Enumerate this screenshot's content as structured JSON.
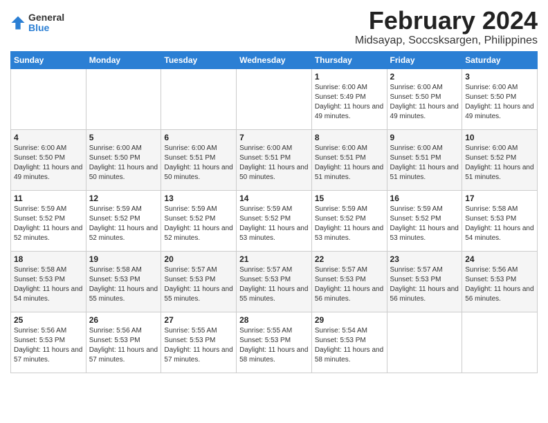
{
  "header": {
    "logo_general": "General",
    "logo_blue": "Blue",
    "title": "February 2024",
    "subtitle": "Midsayap, Soccsksargen, Philippines"
  },
  "days_of_week": [
    "Sunday",
    "Monday",
    "Tuesday",
    "Wednesday",
    "Thursday",
    "Friday",
    "Saturday"
  ],
  "weeks": [
    [
      {
        "day": "",
        "info": ""
      },
      {
        "day": "",
        "info": ""
      },
      {
        "day": "",
        "info": ""
      },
      {
        "day": "",
        "info": ""
      },
      {
        "day": "1",
        "info": "Sunrise: 6:00 AM\nSunset: 5:49 PM\nDaylight: 11 hours and 49 minutes."
      },
      {
        "day": "2",
        "info": "Sunrise: 6:00 AM\nSunset: 5:50 PM\nDaylight: 11 hours and 49 minutes."
      },
      {
        "day": "3",
        "info": "Sunrise: 6:00 AM\nSunset: 5:50 PM\nDaylight: 11 hours and 49 minutes."
      }
    ],
    [
      {
        "day": "4",
        "info": "Sunrise: 6:00 AM\nSunset: 5:50 PM\nDaylight: 11 hours and 49 minutes."
      },
      {
        "day": "5",
        "info": "Sunrise: 6:00 AM\nSunset: 5:50 PM\nDaylight: 11 hours and 50 minutes."
      },
      {
        "day": "6",
        "info": "Sunrise: 6:00 AM\nSunset: 5:51 PM\nDaylight: 11 hours and 50 minutes."
      },
      {
        "day": "7",
        "info": "Sunrise: 6:00 AM\nSunset: 5:51 PM\nDaylight: 11 hours and 50 minutes."
      },
      {
        "day": "8",
        "info": "Sunrise: 6:00 AM\nSunset: 5:51 PM\nDaylight: 11 hours and 51 minutes."
      },
      {
        "day": "9",
        "info": "Sunrise: 6:00 AM\nSunset: 5:51 PM\nDaylight: 11 hours and 51 minutes."
      },
      {
        "day": "10",
        "info": "Sunrise: 6:00 AM\nSunset: 5:52 PM\nDaylight: 11 hours and 51 minutes."
      }
    ],
    [
      {
        "day": "11",
        "info": "Sunrise: 5:59 AM\nSunset: 5:52 PM\nDaylight: 11 hours and 52 minutes."
      },
      {
        "day": "12",
        "info": "Sunrise: 5:59 AM\nSunset: 5:52 PM\nDaylight: 11 hours and 52 minutes."
      },
      {
        "day": "13",
        "info": "Sunrise: 5:59 AM\nSunset: 5:52 PM\nDaylight: 11 hours and 52 minutes."
      },
      {
        "day": "14",
        "info": "Sunrise: 5:59 AM\nSunset: 5:52 PM\nDaylight: 11 hours and 53 minutes."
      },
      {
        "day": "15",
        "info": "Sunrise: 5:59 AM\nSunset: 5:52 PM\nDaylight: 11 hours and 53 minutes."
      },
      {
        "day": "16",
        "info": "Sunrise: 5:59 AM\nSunset: 5:52 PM\nDaylight: 11 hours and 53 minutes."
      },
      {
        "day": "17",
        "info": "Sunrise: 5:58 AM\nSunset: 5:53 PM\nDaylight: 11 hours and 54 minutes."
      }
    ],
    [
      {
        "day": "18",
        "info": "Sunrise: 5:58 AM\nSunset: 5:53 PM\nDaylight: 11 hours and 54 minutes."
      },
      {
        "day": "19",
        "info": "Sunrise: 5:58 AM\nSunset: 5:53 PM\nDaylight: 11 hours and 55 minutes."
      },
      {
        "day": "20",
        "info": "Sunrise: 5:57 AM\nSunset: 5:53 PM\nDaylight: 11 hours and 55 minutes."
      },
      {
        "day": "21",
        "info": "Sunrise: 5:57 AM\nSunset: 5:53 PM\nDaylight: 11 hours and 55 minutes."
      },
      {
        "day": "22",
        "info": "Sunrise: 5:57 AM\nSunset: 5:53 PM\nDaylight: 11 hours and 56 minutes."
      },
      {
        "day": "23",
        "info": "Sunrise: 5:57 AM\nSunset: 5:53 PM\nDaylight: 11 hours and 56 minutes."
      },
      {
        "day": "24",
        "info": "Sunrise: 5:56 AM\nSunset: 5:53 PM\nDaylight: 11 hours and 56 minutes."
      }
    ],
    [
      {
        "day": "25",
        "info": "Sunrise: 5:56 AM\nSunset: 5:53 PM\nDaylight: 11 hours and 57 minutes."
      },
      {
        "day": "26",
        "info": "Sunrise: 5:56 AM\nSunset: 5:53 PM\nDaylight: 11 hours and 57 minutes."
      },
      {
        "day": "27",
        "info": "Sunrise: 5:55 AM\nSunset: 5:53 PM\nDaylight: 11 hours and 57 minutes."
      },
      {
        "day": "28",
        "info": "Sunrise: 5:55 AM\nSunset: 5:53 PM\nDaylight: 11 hours and 58 minutes."
      },
      {
        "day": "29",
        "info": "Sunrise: 5:54 AM\nSunset: 5:53 PM\nDaylight: 11 hours and 58 minutes."
      },
      {
        "day": "",
        "info": ""
      },
      {
        "day": "",
        "info": ""
      }
    ]
  ]
}
